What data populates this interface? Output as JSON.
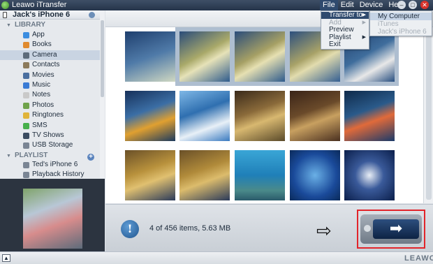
{
  "app": {
    "title": "Leawo iTransfer",
    "brand": "LEAWO"
  },
  "menubar": {
    "items": [
      "File",
      "Edit",
      "Device",
      "Help"
    ]
  },
  "window_controls": {
    "minimize": "–",
    "maximize": "□",
    "close": "✕"
  },
  "sidebar": {
    "device_name": "Jack's iPhone 6",
    "library_header": "LIBRARY",
    "library_items": [
      {
        "label": "App",
        "icon": "app-icon",
        "color": "#3b8de0"
      },
      {
        "label": "Books",
        "icon": "books-icon",
        "color": "#e08a2e"
      },
      {
        "label": "Camera",
        "icon": "camera-icon",
        "color": "#5d6b7a",
        "selected": true
      },
      {
        "label": "Contacts",
        "icon": "contacts-icon",
        "color": "#8c7a5b"
      },
      {
        "label": "Movies",
        "icon": "movies-icon",
        "color": "#4a6fa0"
      },
      {
        "label": "Music",
        "icon": "music-icon",
        "color": "#3a7bd5"
      },
      {
        "label": "Notes",
        "icon": "notes-icon",
        "color": "#c9c9c9"
      },
      {
        "label": "Photos",
        "icon": "photos-icon",
        "color": "#6fa34b"
      },
      {
        "label": "Ringtones",
        "icon": "ringtones-icon",
        "color": "#e0b43a"
      },
      {
        "label": "SMS",
        "icon": "sms-icon",
        "color": "#47b04b"
      },
      {
        "label": "TV Shows",
        "icon": "tv-shows-icon",
        "color": "#3a4b60"
      },
      {
        "label": "USB Storage",
        "icon": "usb-storage-icon",
        "color": "#7a8594"
      }
    ],
    "playlist_header": "PLAYLIST",
    "playlist_items": [
      {
        "label": "Ted's iPhone 6",
        "icon": "playlist-icon",
        "color": "#7a8594"
      },
      {
        "label": "Playback History",
        "icon": "history-icon",
        "color": "#7a8594"
      }
    ]
  },
  "toolbar": {
    "refresh_glyph": "C"
  },
  "status": {
    "text": "4 of 456 items, 5.63 MB"
  },
  "file_menu": {
    "items": [
      {
        "label": "Transfer to",
        "has_submenu": true,
        "state": "active"
      },
      {
        "label": "Add",
        "has_submenu": true,
        "state": "disabled"
      },
      {
        "label": "Preview",
        "state": "normal"
      },
      {
        "label": "Playlist",
        "has_submenu": true,
        "state": "normal"
      },
      {
        "label": "Exit",
        "state": "normal"
      }
    ]
  },
  "transfer_submenu": {
    "items": [
      {
        "label": "My Computer",
        "state": "active"
      },
      {
        "label": "iTunes",
        "state": "disabled"
      },
      {
        "label": "Jack's iPhone 6",
        "state": "disabled"
      }
    ]
  },
  "colors": {
    "accent": "#2f4a6e",
    "highlight_frame": "#e2242a",
    "selection": "#aebed0"
  },
  "photos": [
    {
      "name": "photo-1",
      "selected": false,
      "g": "linear-gradient(160deg,#1f3f6e,#4f7aa8 50%,#d0d8c2)"
    },
    {
      "name": "photo-2",
      "selected": true,
      "g": "linear-gradient(150deg,#2a4c7a,#a9a96a 45%,#e6e2b8 60%,#2e5b8c)"
    },
    {
      "name": "photo-3",
      "selected": true,
      "g": "linear-gradient(150deg,#2a4c7a,#a6a065 45%,#e6e0b2 60%,#2e5b8c)"
    },
    {
      "name": "photo-4",
      "selected": true,
      "g": "linear-gradient(150deg,#2c4f7e,#a8a268 45%,#e2dcae 60%,#345f92)"
    },
    {
      "name": "photo-5",
      "selected": true,
      "g": "linear-gradient(150deg,#1e3d6a,#3f6d9c 45%,#e8e8e8 70%,#274e80)"
    },
    {
      "name": "photo-6",
      "selected": false,
      "g": "linear-gradient(160deg,#17315a,#3b6ea5 40%,#e0a030 65%,#1c3a5e)"
    },
    {
      "name": "photo-7",
      "selected": false,
      "g": "linear-gradient(160deg,#7fb8e6,#2f6fb0 40%,#e8f0f7 70%,#3a7ac0)"
    },
    {
      "name": "photo-8",
      "selected": false,
      "g": "linear-gradient(160deg,#3a2a1a,#8a6a3a 40%,#d8b870 60%,#5a4a2a)"
    },
    {
      "name": "photo-9",
      "selected": false,
      "g": "linear-gradient(160deg,#3a2418,#6a4a2a 40%,#c8a060 60%,#4a3020)"
    },
    {
      "name": "photo-10",
      "selected": false,
      "g": "linear-gradient(160deg,#0f2a4a,#2a5a8a 40%,#e06a3a 60%,#1a3a6a)"
    },
    {
      "name": "photo-11",
      "selected": false,
      "g": "linear-gradient(160deg,#6a5028,#b8913c 40%,#e0c070 60%,#2a3a5a)"
    },
    {
      "name": "photo-12",
      "selected": false,
      "g": "linear-gradient(160deg,#6a5028,#b08a3a 40%,#dcbc6c 60%,#2a3a5a)"
    },
    {
      "name": "photo-13",
      "selected": false,
      "g": "linear-gradient(180deg,#3aa6d6,#1f7fb8 50%,#4a8a8a 80%,#2a5a6a)"
    },
    {
      "name": "photo-14",
      "selected": false,
      "g": "radial-gradient(circle at 50% 50%,#6ab0e6,#1a4a9a 60%,#0a2a5a)"
    },
    {
      "name": "photo-15",
      "selected": false,
      "g": "radial-gradient(circle at 50% 50%,#e8eef6,#3a5a9a 40%,#0a1e4a)"
    }
  ]
}
